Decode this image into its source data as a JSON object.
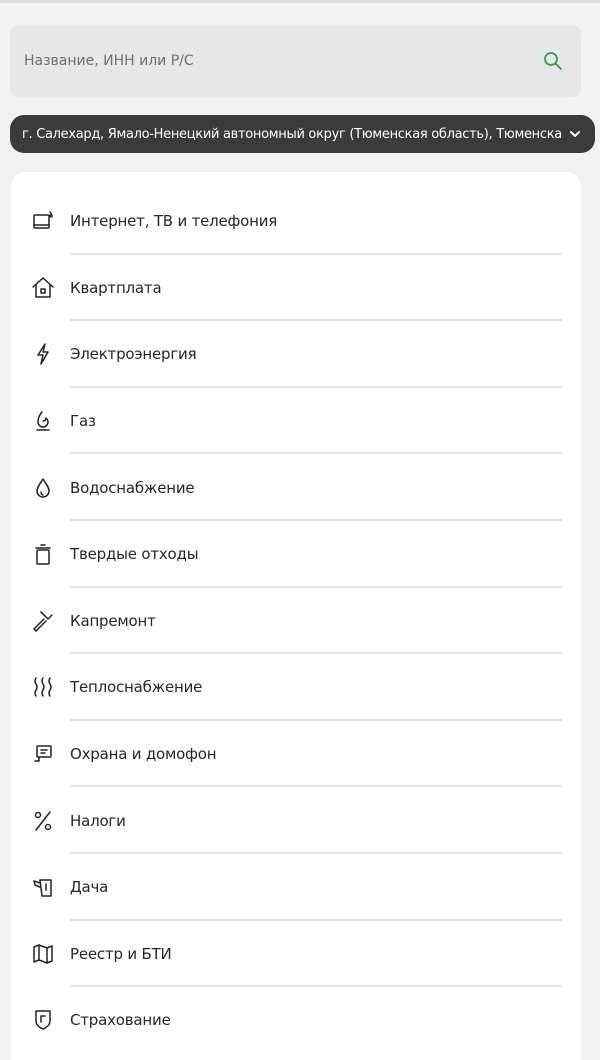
{
  "search": {
    "placeholder": "Название, ИНН или Р/С",
    "accent": "#2e9d4c"
  },
  "region": {
    "label": "г. Салехард, Ямало-Ненецкий автономный округ (Тюменская область), Тюменская область"
  },
  "categories": [
    {
      "label": "Интернет, ТВ и телефония",
      "icon": "tv-icon"
    },
    {
      "label": "Квартплата",
      "icon": "house-icon"
    },
    {
      "label": "Электроэнергия",
      "icon": "lightning-icon"
    },
    {
      "label": "Газ",
      "icon": "flame-icon"
    },
    {
      "label": "Водоснабжение",
      "icon": "water-drop-icon"
    },
    {
      "label": "Твердые отходы",
      "icon": "trash-can-icon"
    },
    {
      "label": "Капремонт",
      "icon": "hammer-icon"
    },
    {
      "label": "Теплоснабжение",
      "icon": "heat-waves-icon"
    },
    {
      "label": "Охрана и домофон",
      "icon": "intercom-icon"
    },
    {
      "label": "Налоги",
      "icon": "percent-icon"
    },
    {
      "label": "Дача",
      "icon": "watering-can-icon"
    },
    {
      "label": "Реестр и БТИ",
      "icon": "map-icon"
    },
    {
      "label": "Страхование",
      "icon": "shield-icon"
    }
  ]
}
